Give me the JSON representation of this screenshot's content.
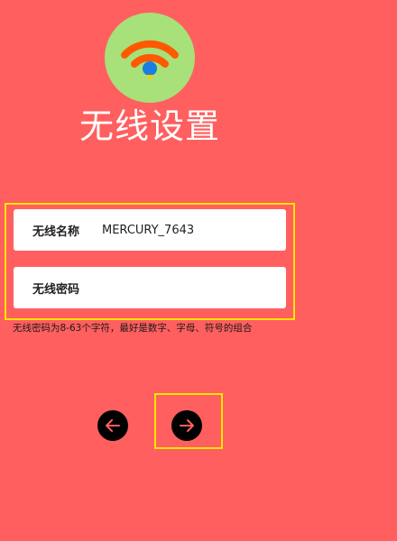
{
  "header": {
    "logo_icon": "wifi-icon",
    "title": "无线设置"
  },
  "form": {
    "ssid": {
      "label": "无线名称",
      "value": "MERCURY_7643"
    },
    "password": {
      "label": "无线密码",
      "value": ""
    },
    "hint": "无线密码为8-63个字符，最好是数字、字母、符号的组合"
  },
  "navigation": {
    "back_icon": "arrow-left-icon",
    "next_icon": "arrow-right-icon"
  },
  "colors": {
    "background": "#ff5f5f",
    "logo_circle": "#a8e07a",
    "wifi_arcs": "#ff5a00",
    "wifi_dot": "#1a7de0",
    "highlight": "#ffe600"
  }
}
